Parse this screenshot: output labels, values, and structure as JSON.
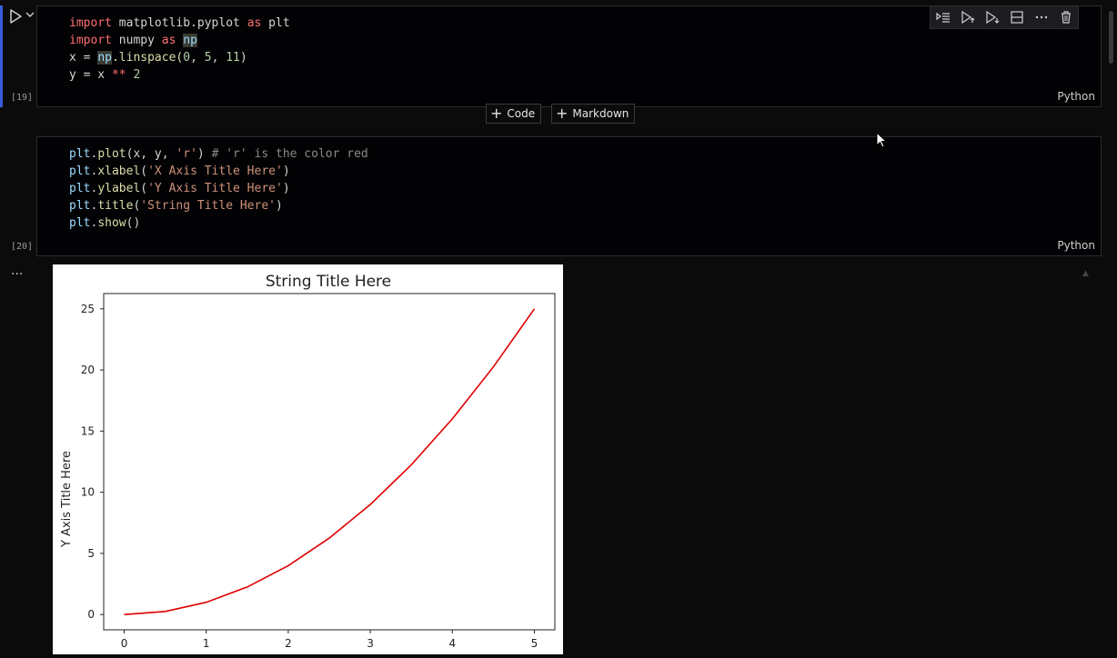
{
  "cell1": {
    "exec_count": "[19]",
    "language": "Python",
    "lines": [
      [
        "import",
        " matplotlib.pyplot ",
        "as",
        " plt"
      ],
      [
        "import",
        " numpy ",
        "as",
        " ",
        "np"
      ],
      [
        "x = ",
        "np",
        ".linspace(",
        "0",
        ", ",
        "5",
        ", ",
        "11",
        ")"
      ],
      [
        "y = x ",
        "**",
        " ",
        "2"
      ]
    ]
  },
  "add_buttons": {
    "code_label": "Code",
    "markdown_label": "Markdown"
  },
  "cell2": {
    "exec_count": "[20]",
    "language": "Python",
    "lines": [
      [
        "plt",
        ".",
        "plot",
        "(x, y, ",
        "'r'",
        ") ",
        "# 'r' is the color red"
      ],
      [
        "plt",
        ".",
        "xlabel",
        "(",
        "'X Axis Title Here'",
        ")"
      ],
      [
        "plt",
        ".",
        "ylabel",
        "(",
        "'Y Axis Title Here'",
        ")"
      ],
      [
        "plt",
        ".",
        "title",
        "(",
        "'String Title Here'",
        ")"
      ],
      [
        "plt",
        ".",
        "show",
        "()"
      ]
    ]
  },
  "toolbar_icons": [
    "execute-above-icon",
    "execute-cell-and-below-icon",
    "execute-cell-and-above-icon",
    "split-cell-icon",
    "more-icon",
    "delete-icon"
  ],
  "output_more_label": "...",
  "chart_data": {
    "type": "line",
    "title": "String Title Here",
    "xlabel": "",
    "ylabel": "Y Axis Title Here",
    "x": [
      0,
      0.5,
      1,
      1.5,
      2,
      2.5,
      3,
      3.5,
      4,
      4.5,
      5
    ],
    "series": [
      {
        "values": [
          0,
          0.25,
          1,
          2.25,
          4,
          6.25,
          9,
          12.25,
          16,
          20.25,
          25
        ],
        "color": "#e00000"
      }
    ],
    "xlim": [
      -0.25,
      5.25
    ],
    "ylim": [
      -1.25,
      26.25
    ],
    "xticks": [
      "0",
      "1",
      "2",
      "3",
      "4",
      "5"
    ],
    "yticks": [
      "0",
      "5",
      "10",
      "15",
      "20",
      "25"
    ],
    "grid": false
  }
}
